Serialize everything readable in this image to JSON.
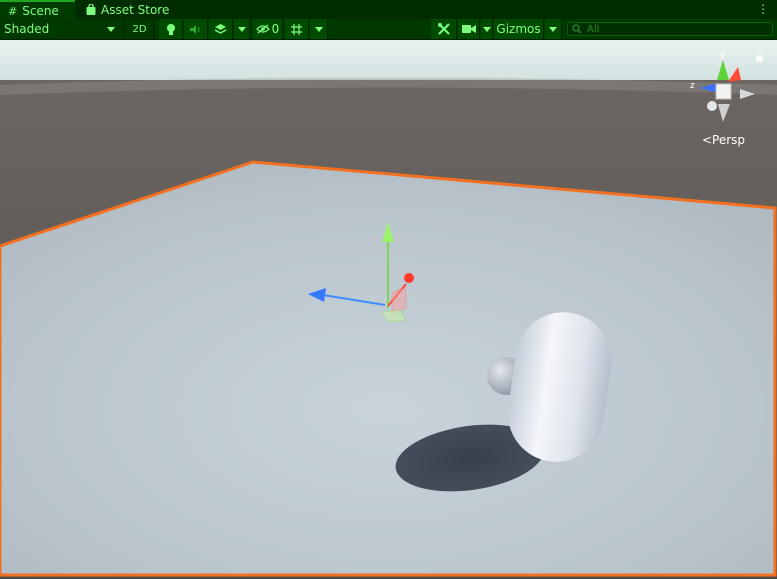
{
  "tabs": [
    {
      "label": "Scene",
      "icon": "grid-hash-icon"
    },
    {
      "label": "Asset Store",
      "icon": "shopping-bag-icon"
    }
  ],
  "toolbar": {
    "shading_mode": "Shaded",
    "mode_2d": "2D",
    "hidden_count": "0",
    "gizmos_label": "Gizmos",
    "search_placeholder": "All"
  },
  "scene": {
    "projection_label": "<Persp",
    "gizmo_axis_y": "y",
    "gizmo_axis_z": "z"
  },
  "colors": {
    "accent": "#7dff7d",
    "selection_outline": "#f37021",
    "sky": "#d8e8e6",
    "ground": "#595451"
  }
}
